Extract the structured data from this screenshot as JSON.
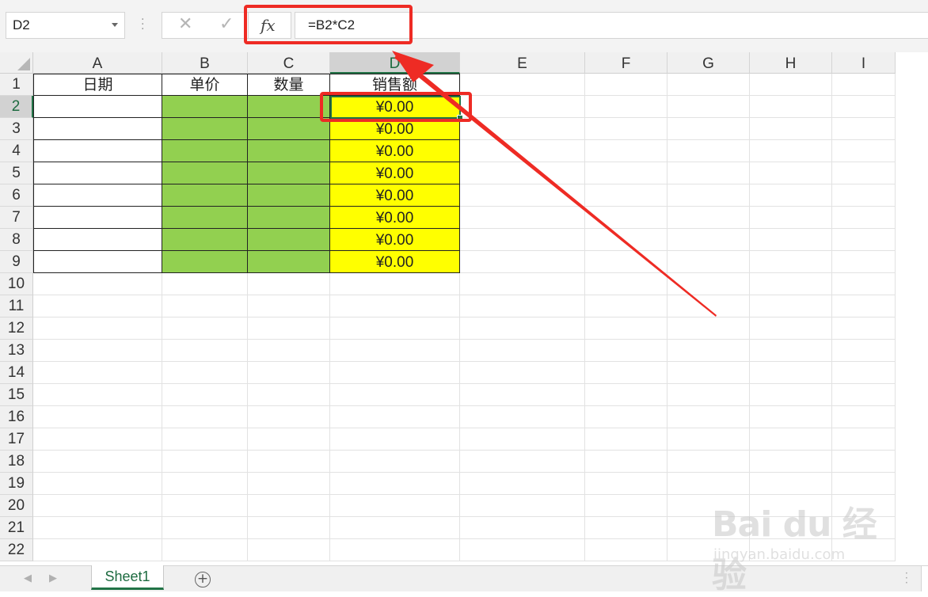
{
  "formula_bar": {
    "name_box": "D2",
    "cancel_icon": "close-icon",
    "enter_icon": "checkmark-icon",
    "fx_label": "fx",
    "formula": "=B2*C2"
  },
  "columns": [
    "A",
    "B",
    "C",
    "D",
    "E",
    "F",
    "G",
    "H",
    "I"
  ],
  "active_column": "D",
  "rows": [
    "1",
    "2",
    "3",
    "4",
    "5",
    "6",
    "7",
    "8",
    "9",
    "10",
    "11",
    "12",
    "13",
    "14",
    "15",
    "16",
    "17",
    "18",
    "19",
    "20",
    "21",
    "22"
  ],
  "active_row": "2",
  "cells": {
    "A1": "日期",
    "B1": "单价",
    "C1": "数量",
    "D1": "销售额",
    "D2": "¥0.00",
    "D3": "¥0.00",
    "D4": "¥0.00",
    "D5": "¥0.00",
    "D6": "¥0.00",
    "D7": "¥0.00",
    "D8": "¥0.00",
    "D9": "¥0.00"
  },
  "fill_colors": {
    "B": "#92d050",
    "C": "#92d050",
    "D": "#ffff00"
  },
  "sheet_tabs": [
    {
      "label": "Sheet1",
      "active": true
    }
  ],
  "add_sheet_icon": "plus-circle-icon",
  "annotation_color": "#ee2b24",
  "watermark": {
    "logo": "Bai du 经验",
    "url": "jingyan.baidu.com"
  }
}
